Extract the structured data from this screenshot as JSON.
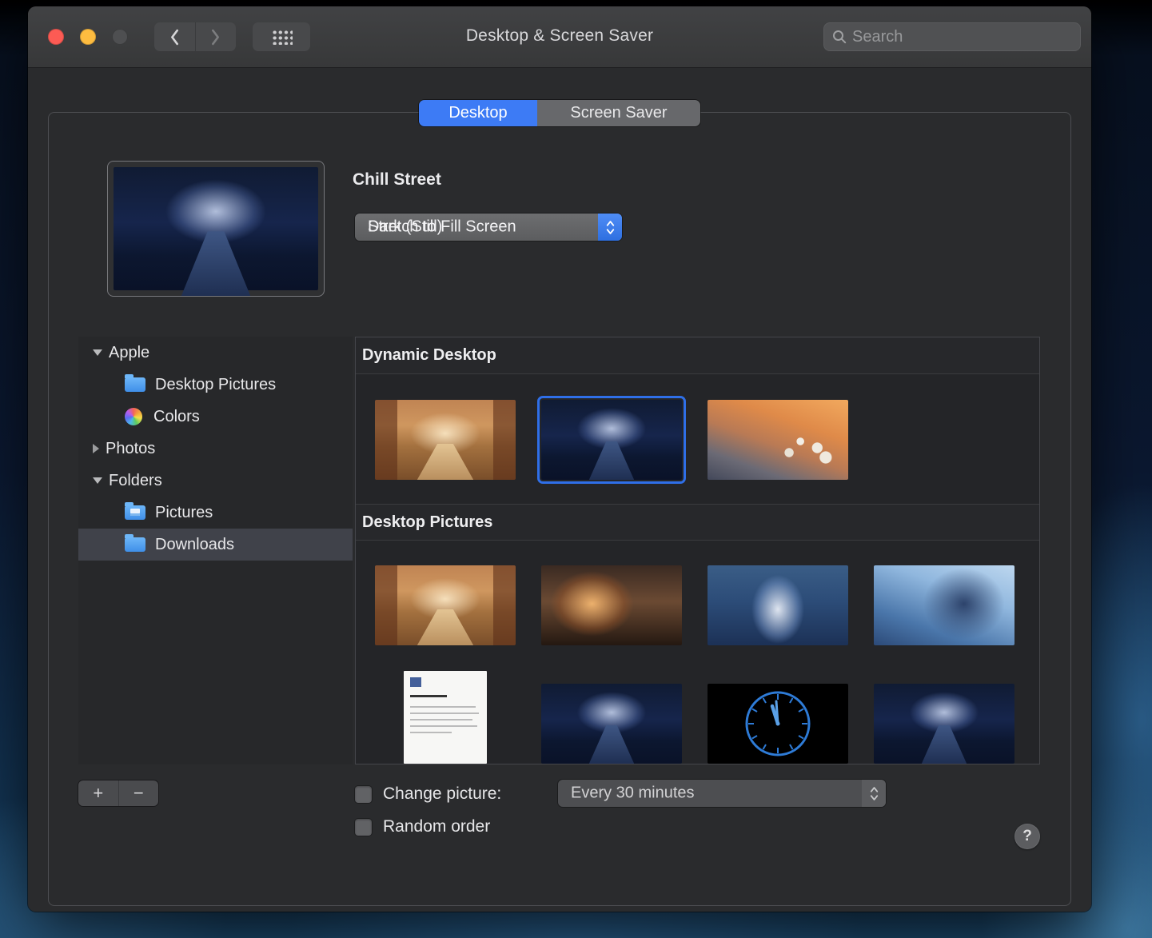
{
  "colors": {
    "accent_blue": "#3d7bf5",
    "selection_blue": "#2f6fe8",
    "folder_blue": "#4f9cf0"
  },
  "titlebar": {
    "title": "Desktop & Screen Saver",
    "search_placeholder": "Search"
  },
  "tabs": {
    "desktop": "Desktop",
    "screensaver": "Screen Saver"
  },
  "preview": {
    "title": "Chill Street",
    "dropdown": {
      "overlap_a": "Dark (Still)",
      "overlap_b": "Stretch to Fill Screen"
    }
  },
  "sidebar": {
    "items": [
      {
        "label": "Apple",
        "type": "group",
        "disclosure": "open"
      },
      {
        "label": "Desktop Pictures",
        "icon": "folder"
      },
      {
        "label": "Colors",
        "icon": "color-wheel"
      },
      {
        "label": "Photos",
        "type": "group",
        "disclosure": "closed"
      },
      {
        "label": "Folders",
        "type": "group",
        "disclosure": "open"
      },
      {
        "label": "Pictures",
        "icon": "pictures-folder"
      },
      {
        "label": "Downloads",
        "icon": "folder",
        "selected": true
      }
    ]
  },
  "sections": {
    "dynamic": {
      "title": "Dynamic Desktop",
      "thumbnails": [
        {
          "name": "warm-street"
        },
        {
          "name": "chill-street-night",
          "selected": true
        },
        {
          "name": "santorini-sunset"
        }
      ]
    },
    "pictures": {
      "title": "Desktop Pictures",
      "thumbnails": [
        {
          "name": "warm-street"
        },
        {
          "name": "anime-portrait-warm"
        },
        {
          "name": "anime-portrait-blue"
        },
        {
          "name": "anime-portrait-ice"
        },
        {
          "name": "document"
        },
        {
          "name": "chill-street-night"
        },
        {
          "name": "clock"
        },
        {
          "name": "chill-street-night"
        }
      ]
    }
  },
  "footer": {
    "add": "+",
    "remove": "−",
    "change_picture_label": "Change picture:",
    "change_picture_checked": false,
    "interval_value": "Every 30 minutes",
    "random_order_label": "Random order",
    "random_order_checked": false,
    "help": "?"
  }
}
